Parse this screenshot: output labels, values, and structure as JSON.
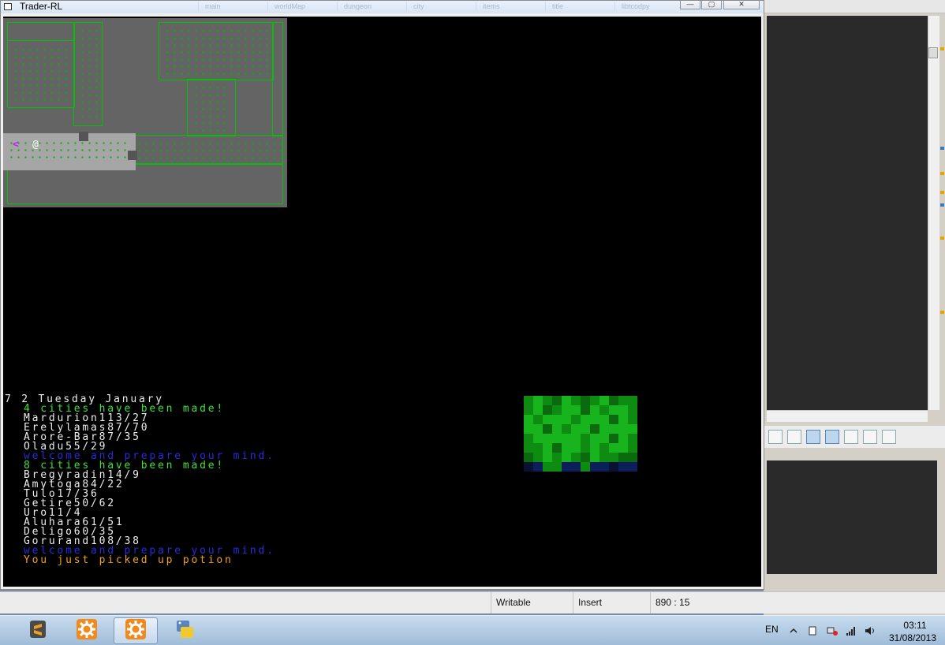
{
  "window": {
    "title": "Trader-RL",
    "ghost_tabs": [
      "main",
      "worldMap",
      "dungeon",
      "city",
      "items",
      "title",
      "libtcodpy"
    ],
    "minimize_label": "—",
    "maximize_label": "▢",
    "close_label": "✕"
  },
  "map": {
    "stair_char": "<",
    "player_char": "@"
  },
  "log": {
    "lines": [
      {
        "text": "7 2 Tuesday January",
        "color": "white",
        "indent": false
      },
      {
        "text": "4 cities have been made!",
        "color": "green",
        "indent": true
      },
      {
        "text": "Mardurion113/27",
        "color": "white",
        "indent": true
      },
      {
        "text": "Erelylamas87/70",
        "color": "white",
        "indent": true
      },
      {
        "text": "Arore-Bar87/35",
        "color": "white",
        "indent": true
      },
      {
        "text": "Oladu55/29",
        "color": "white",
        "indent": true
      },
      {
        "text": "welcome and prepare your mind.",
        "color": "blue",
        "indent": true
      },
      {
        "text": "8 cities have been made!",
        "color": "green",
        "indent": true
      },
      {
        "text": "Bregyradin14/9",
        "color": "white",
        "indent": true
      },
      {
        "text": "Amytoga84/22",
        "color": "white",
        "indent": true
      },
      {
        "text": "Tulo17/36",
        "color": "white",
        "indent": true
      },
      {
        "text": "Getire50/62",
        "color": "white",
        "indent": true
      },
      {
        "text": "Uro11/4",
        "color": "white",
        "indent": true
      },
      {
        "text": "Aluhara61/51",
        "color": "white",
        "indent": true
      },
      {
        "text": "Deligo60/35",
        "color": "white",
        "indent": true
      },
      {
        "text": "Gorurand108/38",
        "color": "white",
        "indent": true
      },
      {
        "text": "welcome and prepare your mind.",
        "color": "blue",
        "indent": true
      },
      {
        "text": "You just picked up potion",
        "color": "orange",
        "indent": true
      }
    ]
  },
  "minimap": {
    "palette": {
      "g": "#0e8c12",
      "G": "#17b41e",
      "d": "#0a6a0d",
      "b": "#0c1f5a",
      "k": "#081233"
    },
    "rows": [
      "gGgdGgdgGdgg",
      "gGdgGGdGgGGg",
      "GgGGGgGGGdGg",
      "GGdGgGGdGGGG",
      "gGGGGGgGGdGg",
      "ggGdGGgGgGGg",
      "dgGgGgdGggdd",
      "kbggbbgbbkbb"
    ]
  },
  "statusbar": {
    "mode": "Writable",
    "insert": "Insert",
    "position": "890 : 15"
  },
  "taskbar": {
    "apps": [
      {
        "name": "sublime-text-icon",
        "active": false
      },
      {
        "name": "gear-app-icon",
        "active": false
      },
      {
        "name": "gear-app-icon",
        "active": true
      },
      {
        "name": "python-icon",
        "active": false
      }
    ],
    "language": "EN",
    "time": "03:11",
    "date": "31/08/2013"
  },
  "colors": {
    "console_bg": "#000000",
    "map_floor": "#646464",
    "wall": "#00c400",
    "log_white": "#ededed",
    "log_green": "#3ce23c",
    "log_blue": "#2a2ae0",
    "log_orange": "#f0a020"
  }
}
